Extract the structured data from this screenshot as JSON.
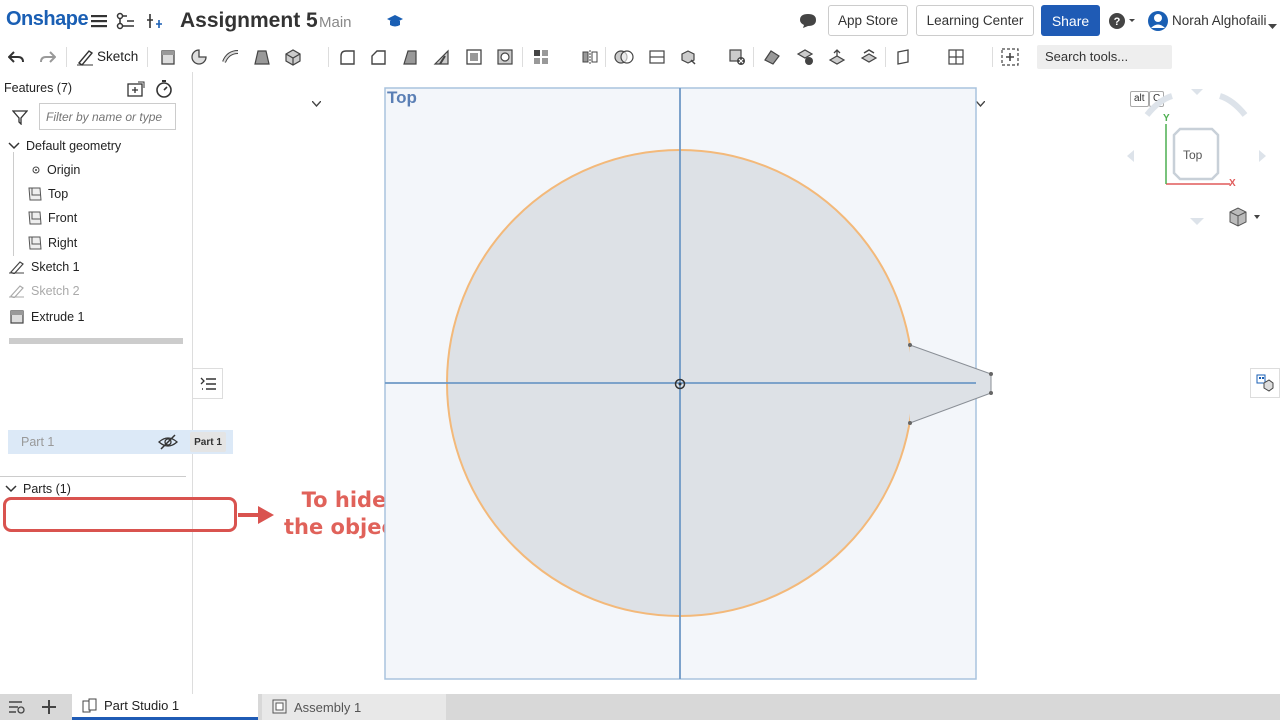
{
  "header": {
    "logo": "Onshape",
    "document_title": "Assignment 5",
    "branch": "Main",
    "app_store_label": "App Store",
    "learning_center_label": "Learning Center",
    "share_label": "Share",
    "user_name": "Norah Alghofaili"
  },
  "toolbar": {
    "sketch_label": "Sketch",
    "search_tools_label": "Search tools...",
    "shortcut_key_1": "alt",
    "shortcut_key_2": "C"
  },
  "feature_panel": {
    "title": "Features (7)",
    "filter_placeholder": "Filter by name or type",
    "default_geometry_label": "Default geometry",
    "origin_label": "Origin",
    "top_plane_label": "Top",
    "front_plane_label": "Front",
    "right_plane_label": "Right",
    "sketch1_label": "Sketch 1",
    "sketch2_label": "Sketch 2",
    "extrude1_label": "Extrude 1"
  },
  "parts_panel": {
    "title": "Parts (1)",
    "part_name": "Part 1",
    "part_tag": "Part 1"
  },
  "annotation": {
    "line1": "To hide",
    "line2": "the object"
  },
  "viewport": {
    "plane_label": "Top",
    "view_cube_label": "Top",
    "axis_x": "X",
    "axis_y": "Y"
  },
  "tabs": {
    "part_studio_label": "Part Studio 1",
    "assembly_label": "Assembly 1"
  },
  "colors": {
    "brand": "#1a5fb4",
    "share": "#1f5bb5",
    "annotation": "#e0625a",
    "plane_fill": "#f2f6fa",
    "plane_stroke": "#a9c3de",
    "circle_stroke": "#f3b97a",
    "circle_fill": "#dce0e5"
  }
}
